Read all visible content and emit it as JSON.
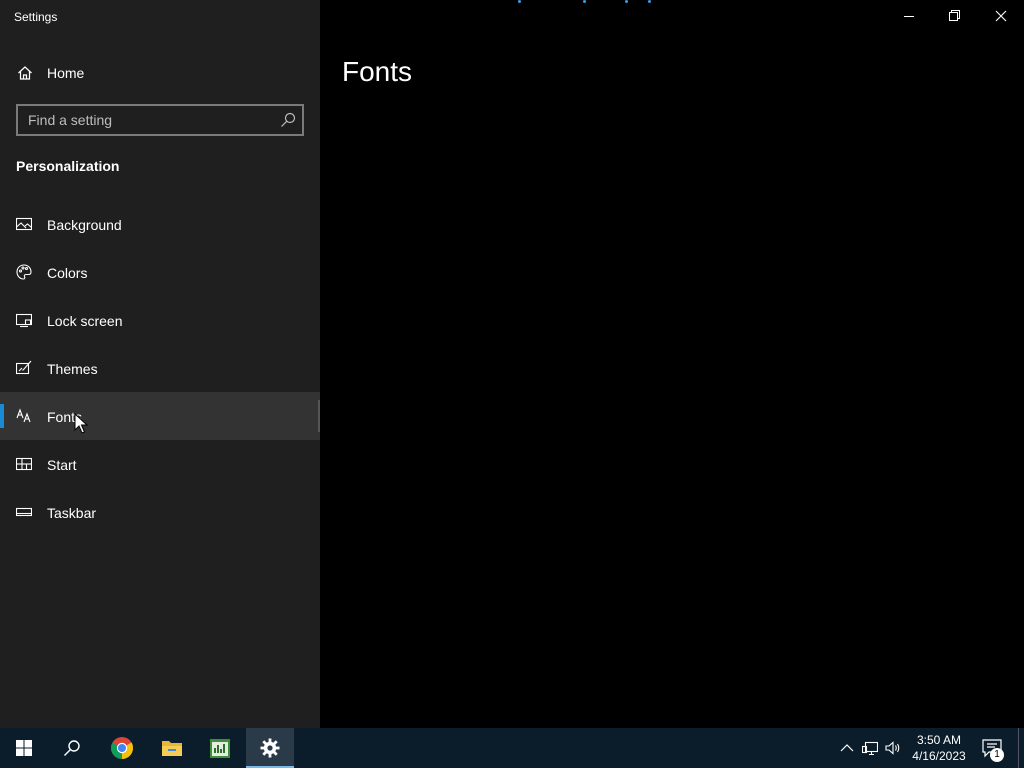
{
  "window": {
    "title": "Settings",
    "minimize_icon": "minimize-icon",
    "restore_icon": "restore-icon",
    "close_icon": "close-icon"
  },
  "sidebar": {
    "home_label": "Home",
    "search_placeholder": "Find a setting",
    "section_title": "Personalization",
    "items": [
      {
        "label": "Background",
        "icon": "image-icon",
        "selected": false
      },
      {
        "label": "Colors",
        "icon": "palette-icon",
        "selected": false
      },
      {
        "label": "Lock screen",
        "icon": "lock-screen-icon",
        "selected": false
      },
      {
        "label": "Themes",
        "icon": "themes-icon",
        "selected": false
      },
      {
        "label": "Fonts",
        "icon": "fonts-icon",
        "selected": true
      },
      {
        "label": "Start",
        "icon": "start-icon",
        "selected": false
      },
      {
        "label": "Taskbar",
        "icon": "taskbar-icon",
        "selected": false
      }
    ]
  },
  "main": {
    "page_title": "Fonts"
  },
  "taskbar": {
    "clock_time": "3:50 AM",
    "clock_date": "4/16/2023",
    "notification_count": "1",
    "apps": [
      "start-icon",
      "search-icon",
      "chrome-icon",
      "file-explorer-icon",
      "spreadsheet-icon",
      "settings-gear-icon"
    ]
  },
  "colors": {
    "accent": "#1a8ad4",
    "sidebar_bg": "#1f1f1f",
    "content_bg": "#000000",
    "taskbar_bg": "#0b1d2a"
  }
}
